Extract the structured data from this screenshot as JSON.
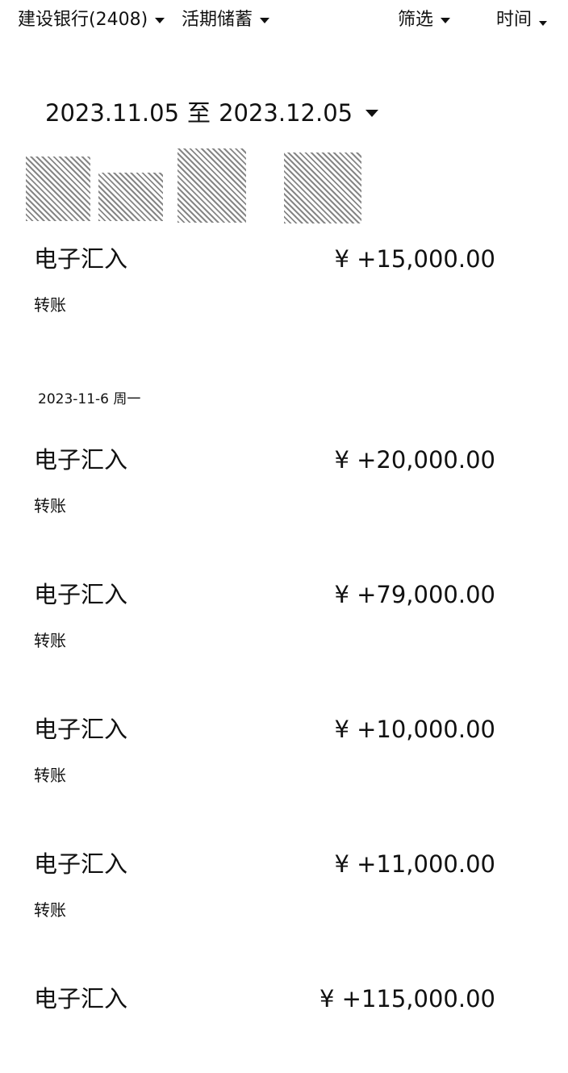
{
  "header": {
    "account_label": "建设银行(2408)",
    "account_type_label": "活期储蓄",
    "filter_label": "筛选",
    "time_label": "时间"
  },
  "date_range": {
    "start": "2023.11.05",
    "separator": "至",
    "end": "2023.12.05"
  },
  "date_groups": [
    {
      "label": "2023-11-6 周一"
    }
  ],
  "transactions": [
    {
      "title": "电子汇入",
      "amount": "¥ +15,000.00",
      "type": "转账"
    },
    {
      "title": "电子汇入",
      "amount": "¥ +20,000.00",
      "type": "转账"
    },
    {
      "title": "电子汇入",
      "amount": "¥ +79,000.00",
      "type": "转账"
    },
    {
      "title": "电子汇入",
      "amount": "¥ +10,000.00",
      "type": "转账"
    },
    {
      "title": "电子汇入",
      "amount": "¥ +11,000.00",
      "type": "转账"
    },
    {
      "title": "电子汇入",
      "amount": "¥ +115,000.00"
    }
  ]
}
